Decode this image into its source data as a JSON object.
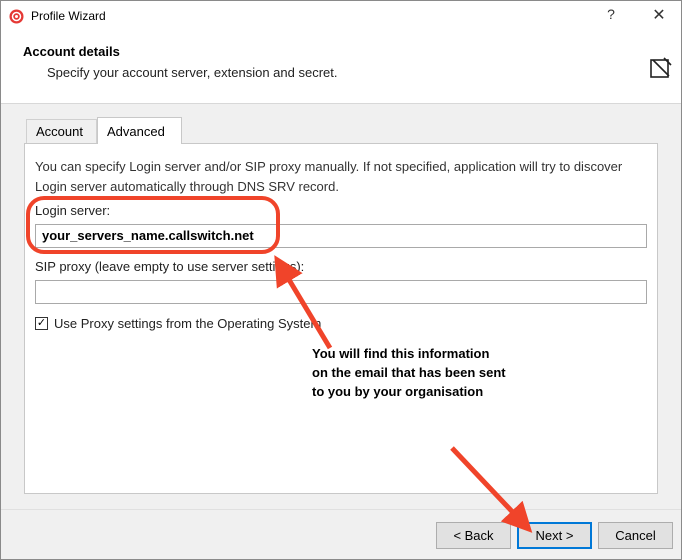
{
  "window": {
    "title": "Profile Wizard",
    "help_glyph": "?",
    "close_glyph": "✕"
  },
  "header": {
    "title": "Account details",
    "subtitle": "Specify your account server, extension and secret."
  },
  "tabs": [
    {
      "label": "Account",
      "active": false
    },
    {
      "label": "Advanced",
      "active": true
    }
  ],
  "advanced": {
    "description": "You can specify Login server and/or SIP proxy manually. If not specified, application will try to discover Login server automatically through DNS SRV record.",
    "login_server_label": "Login server:",
    "login_server_value": "your_servers_name.callswitch.net",
    "sip_proxy_label": "SIP proxy (leave empty to use server settings):",
    "sip_proxy_value": "",
    "use_proxy_label": "Use Proxy settings from the Operating System",
    "use_proxy_checked": true
  },
  "annotation": {
    "line1": "You will find this information",
    "line2": "on the email that has been sent",
    "line3": "to you by your organisation",
    "color": "#f0442a"
  },
  "buttons": {
    "back": "< Back",
    "next": "Next >",
    "cancel": "Cancel"
  },
  "colors": {
    "accent": "#0078d7",
    "app_icon": "#e53935"
  }
}
